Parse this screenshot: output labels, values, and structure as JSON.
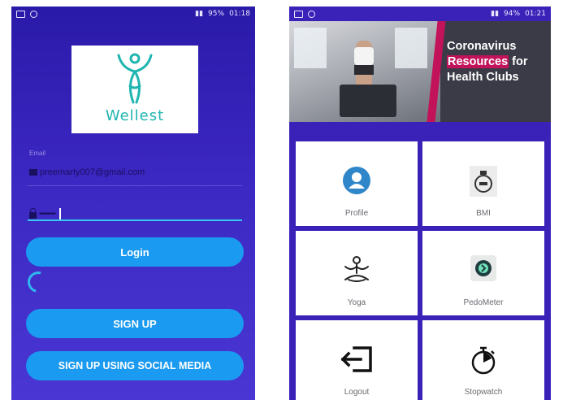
{
  "login_screen": {
    "status": {
      "battery": "95%",
      "time": "01:18"
    },
    "logo_text": "Wellest",
    "email_label": "Email",
    "email_value": "preemarty007@gmail.com",
    "password_value": "••••••••",
    "buttons": {
      "login": "Login",
      "sign_up": "SIGN UP",
      "social": "SIGN UP USING SOCIAL MEDIA"
    }
  },
  "dashboard_screen": {
    "status": {
      "battery": "94%",
      "time": "01:21"
    },
    "banner": {
      "line1": "Coronavirus",
      "highlight": "Resources",
      "line2_rest": " for",
      "line3": "Health Clubs"
    },
    "tiles": [
      {
        "label": "Profile",
        "icon": "profile-icon"
      },
      {
        "label": "BMI",
        "icon": "bmi-icon"
      },
      {
        "label": "Yoga",
        "icon": "yoga-icon"
      },
      {
        "label": "PedoMeter",
        "icon": "pedometer-icon"
      },
      {
        "label": "Logout",
        "icon": "logout-icon"
      },
      {
        "label": "Stopwatch",
        "icon": "stopwatch-icon"
      }
    ]
  },
  "colors": {
    "login_bg": "#3a26c0",
    "button": "#1a9af0",
    "accent": "#c2135a",
    "logo_teal": "#1fb5b0"
  }
}
